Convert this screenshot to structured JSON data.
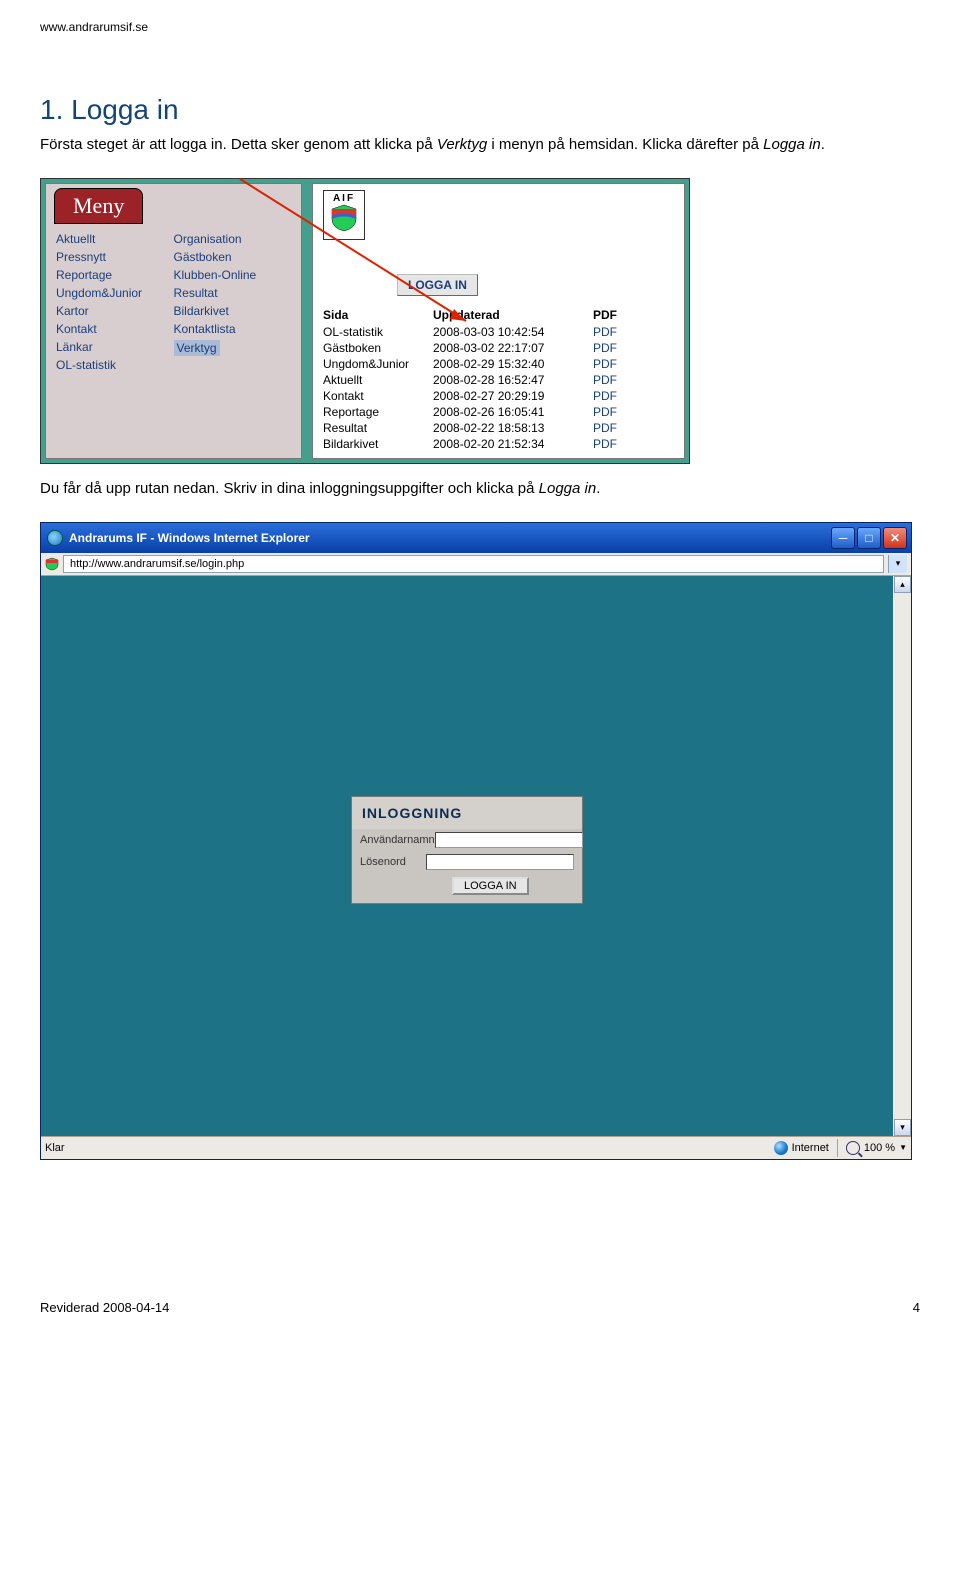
{
  "header_url": "www.andrarumsif.se",
  "heading": "1. Logga in",
  "intro": {
    "part1": "Första steget är att logga in. Detta sker genom att klicka på ",
    "ital1": "Verktyg",
    "part2": " i menyn på hemsidan. Klicka därefter på ",
    "ital2": "Logga in",
    "part3": "."
  },
  "menu": {
    "title": "Meny",
    "col1": [
      "Aktuellt",
      "Pressnytt",
      "Reportage",
      "Ungdom&Junior",
      "Kartor",
      "Kontakt",
      "Länkar",
      "OL-statistik"
    ],
    "col2": [
      "Organisation",
      "Gästboken",
      "Klubben-Online",
      "Resultat",
      "Bildarkivet",
      "Kontaktlista",
      "Verktyg"
    ]
  },
  "aif_label": "AIF",
  "login_button1": "LOGGA IN",
  "table": {
    "h1": "Sida",
    "h2": "Uppdaterad",
    "h3": "PDF",
    "rows": [
      [
        "OL-statistik",
        "2008-03-03 10:42:54",
        "PDF"
      ],
      [
        "Gästboken",
        "2008-03-02 22:17:07",
        "PDF"
      ],
      [
        "Ungdom&Junior",
        "2008-02-29 15:32:40",
        "PDF"
      ],
      [
        "Aktuellt",
        "2008-02-28 16:52:47",
        "PDF"
      ],
      [
        "Kontakt",
        "2008-02-27 20:29:19",
        "PDF"
      ],
      [
        "Reportage",
        "2008-02-26 16:05:41",
        "PDF"
      ],
      [
        "Resultat",
        "2008-02-22 18:58:13",
        "PDF"
      ],
      [
        "Bildarkivet",
        "2008-02-20 21:52:34",
        "PDF"
      ]
    ]
  },
  "mid_text": {
    "part1": "Du får då upp rutan nedan. Skriv in dina inloggningsuppgifter och klicka på ",
    "ital": "Logga in",
    "part2": "."
  },
  "ie": {
    "title": "Andrarums IF - Windows Internet Explorer",
    "address": "http://www.andrarumsif.se/login.php",
    "login_heading": "INLOGGNING",
    "user_label": "Användarnamn",
    "pass_label": "Lösenord",
    "submit": "LOGGA IN",
    "status_ready": "Klar",
    "status_zone": "Internet",
    "zoom": "100 %"
  },
  "footer": {
    "left": "Reviderad 2008-04-14",
    "right": "4"
  }
}
